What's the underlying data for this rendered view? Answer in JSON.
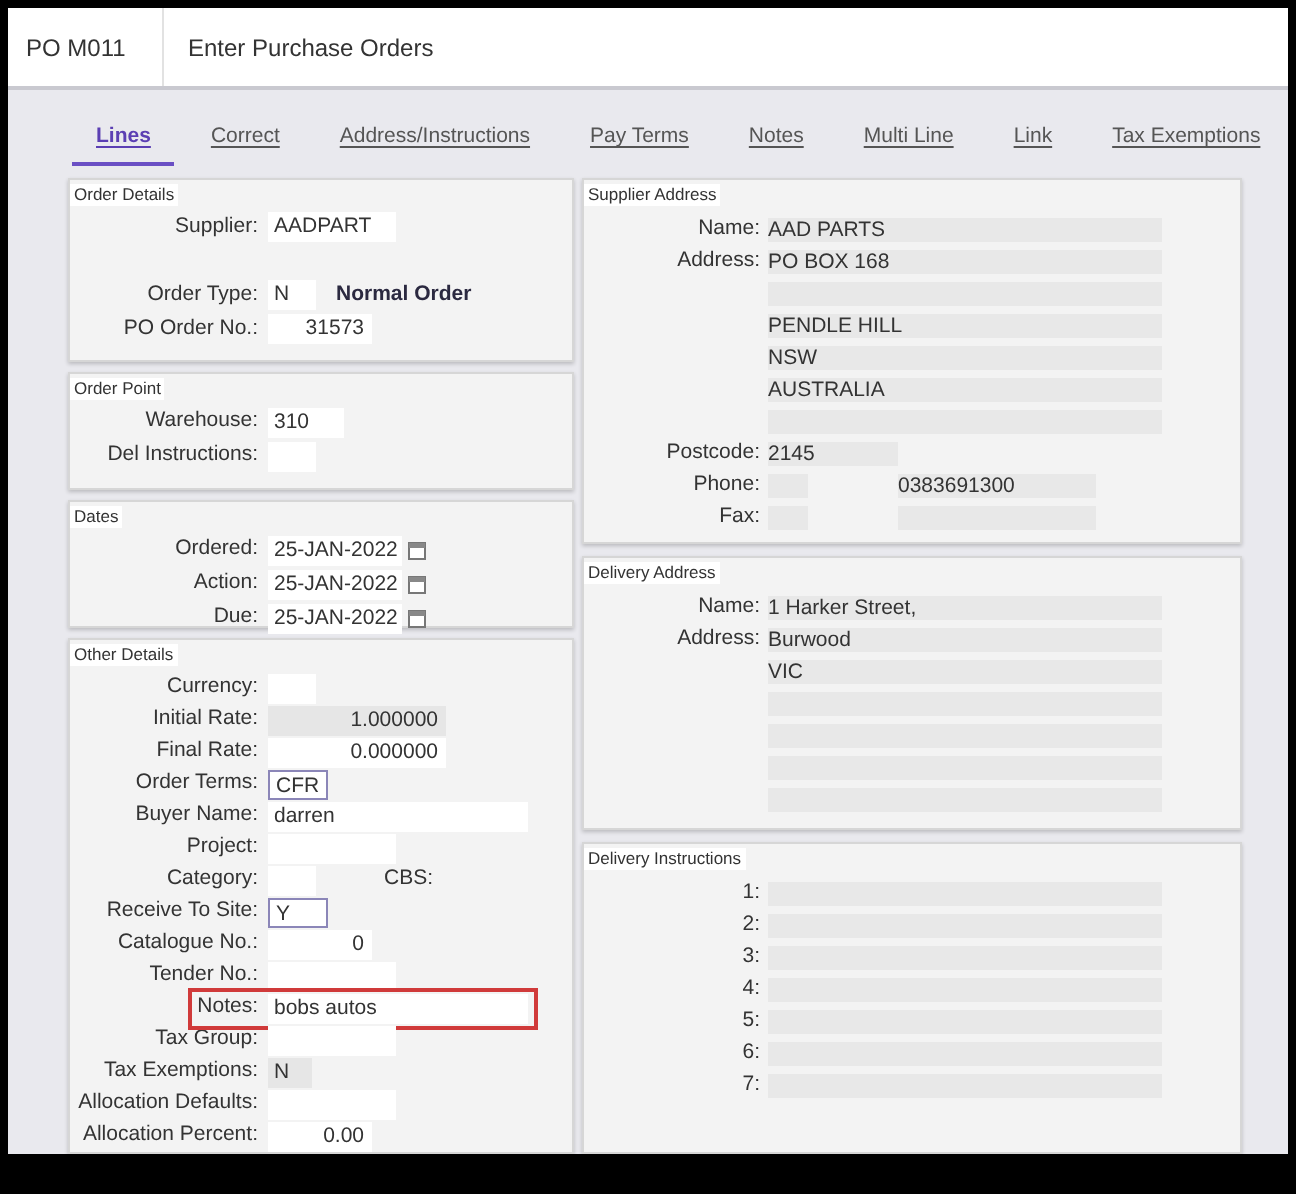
{
  "header": {
    "code": "PO M011",
    "title": "Enter Purchase Orders"
  },
  "tabs": [
    {
      "label": "Lines",
      "selected": true
    },
    {
      "label": "Correct",
      "selected": false
    },
    {
      "label": "Address/Instructions",
      "selected": false
    },
    {
      "label": "Pay Terms",
      "selected": false
    },
    {
      "label": "Notes",
      "selected": false
    },
    {
      "label": "Multi Line",
      "selected": false
    },
    {
      "label": "Link",
      "selected": false
    },
    {
      "label": "Tax Exemptions",
      "selected": false
    }
  ],
  "left_panels": [
    {
      "title": "Order Details",
      "fields": [
        {
          "label": "Supplier:",
          "value": "AADPART",
          "kind": "medium"
        },
        {
          "kind": "spacer"
        },
        {
          "label": "Order Type:",
          "value": "N",
          "kind": "code",
          "extra": "Normal Order"
        },
        {
          "label": "PO Order No.:",
          "value": "31573",
          "kind": "number"
        }
      ]
    },
    {
      "title": "Order Point",
      "fields": [
        {
          "label": "Warehouse:",
          "value": "310",
          "kind": "short"
        },
        {
          "label": "Del Instructions:",
          "kind": "code"
        }
      ]
    },
    {
      "title": "Dates",
      "fields": [
        {
          "label": "Ordered:",
          "value": "25-JAN-2022",
          "kind": "date"
        },
        {
          "label": "Action:",
          "value": "25-JAN-2022",
          "kind": "date"
        },
        {
          "label": "Due:",
          "value": "25-JAN-2022",
          "kind": "date"
        }
      ]
    },
    {
      "title": "Other Details",
      "fields": [
        {
          "label": "Currency:",
          "kind": "code"
        },
        {
          "label": "Initial Rate:",
          "value": "1.000000",
          "kind": "readonly_number"
        },
        {
          "label": "Final Rate:",
          "value": "0.000000",
          "kind": "wide_number"
        },
        {
          "label": "Order Terms:",
          "value": "CFR",
          "kind": "lookup"
        },
        {
          "label": "Buyer Name:",
          "value": "darren",
          "kind": "long"
        },
        {
          "label": "Project:",
          "kind": "medium"
        },
        {
          "label": "Category:",
          "kind": "code",
          "extra": "CBS:"
        },
        {
          "label": "Receive To Site:",
          "value": "Y",
          "kind": "lookup"
        },
        {
          "label": "Catalogue No.:",
          "value": "0",
          "kind": "number"
        },
        {
          "label": "Tender No.:",
          "kind": "medium"
        },
        {
          "label": "Notes:",
          "value": "bobs autos",
          "kind": "long",
          "highlighted": true
        },
        {
          "label": "Tax Group:",
          "kind": "medium"
        },
        {
          "label": "Tax Exemptions:",
          "value": "N",
          "kind": "readonly_code"
        },
        {
          "label": "Allocation Defaults:",
          "kind": "medium"
        },
        {
          "label": "Allocation Percent:",
          "value": "0.00",
          "kind": "number"
        }
      ]
    }
  ],
  "right_panels": [
    {
      "title": "Supplier Address",
      "rows": [
        {
          "label": "Name:",
          "value": "AAD PARTS",
          "kind": "wide"
        },
        {
          "label": "Address:",
          "value": "PO BOX 168",
          "kind": "wide"
        },
        {
          "kind": "wide"
        },
        {
          "value": "PENDLE HILL",
          "kind": "wide"
        },
        {
          "value": "NSW",
          "kind": "wide"
        },
        {
          "value": "AUSTRALIA",
          "kind": "wide"
        },
        {
          "kind": "wide"
        },
        {
          "label": "Postcode:",
          "value": "2145",
          "kind": "short"
        },
        {
          "label": "Phone:",
          "value": "0383691300",
          "kind": "pair"
        },
        {
          "label": "Fax:",
          "kind": "pair"
        }
      ]
    },
    {
      "title": "Delivery Address",
      "rows": [
        {
          "label": "Name:",
          "value": "1 Harker Street,",
          "kind": "wide"
        },
        {
          "label": "Address:",
          "value": "Burwood",
          "kind": "wide"
        },
        {
          "value": "VIC",
          "kind": "wide"
        },
        {
          "kind": "wide"
        },
        {
          "kind": "wide"
        },
        {
          "kind": "wide"
        },
        {
          "kind": "wide"
        }
      ]
    },
    {
      "title": "Delivery Instructions",
      "rows": [
        {
          "label": "1:",
          "kind": "wide"
        },
        {
          "label": "2:",
          "kind": "wide"
        },
        {
          "label": "3:",
          "kind": "wide"
        },
        {
          "label": "4:",
          "kind": "wide"
        },
        {
          "label": "5:",
          "kind": "wide"
        },
        {
          "label": "6:",
          "kind": "wide"
        },
        {
          "label": "7:",
          "kind": "wide"
        }
      ]
    }
  ]
}
